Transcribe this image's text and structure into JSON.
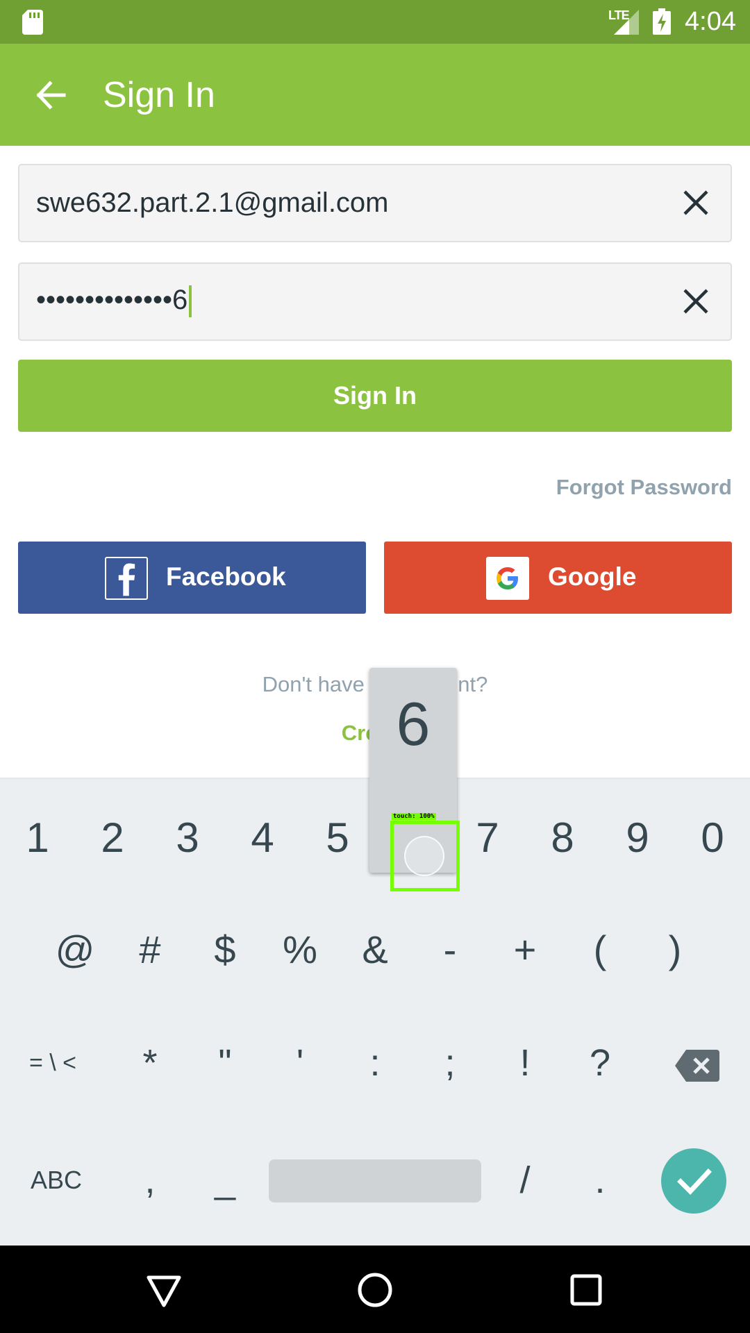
{
  "status_bar": {
    "time": "4:04",
    "network": "LTE",
    "icons": [
      "sd-card-icon",
      "signal-icon",
      "battery-charging-icon"
    ]
  },
  "app_bar": {
    "title": "Sign In",
    "back_icon": "arrow-back-icon"
  },
  "form": {
    "email_value": "swe632.part.2.1@gmail.com",
    "password_value": "••••••••••••••6",
    "clear_icon": "close-icon",
    "signin_label": "Sign In",
    "forgot_label": "Forgot Password"
  },
  "social": {
    "facebook_label": "Facebook",
    "facebook_logo": "f",
    "google_label": "Google",
    "google_logo": "G"
  },
  "footer": {
    "no_account_text": "Don't have an account?",
    "create_label": "Create"
  },
  "keyboard": {
    "preview_key": "6",
    "touch_label": "touch: 100%",
    "row1": [
      "1",
      "2",
      "3",
      "4",
      "5",
      "6",
      "7",
      "8",
      "9",
      "0"
    ],
    "row2": [
      "@",
      "#",
      "$",
      "%",
      "&",
      "-",
      "+",
      "(",
      ")"
    ],
    "row3": [
      "= \\ <",
      "*",
      "\"",
      "'",
      ":",
      ";",
      "!",
      "?"
    ],
    "row4_left": "ABC",
    "row4_comma": ",",
    "row4_underscore": "_",
    "row4_slash": "/",
    "row4_period": ".",
    "backspace_icon": "backspace-icon",
    "enter_icon": "checkmark-icon"
  },
  "colors": {
    "status_bar": "#70a034",
    "app_bar": "#8bc340",
    "facebook": "#3b5999",
    "google": "#dd4b31",
    "enter_key": "#4db6ac"
  }
}
